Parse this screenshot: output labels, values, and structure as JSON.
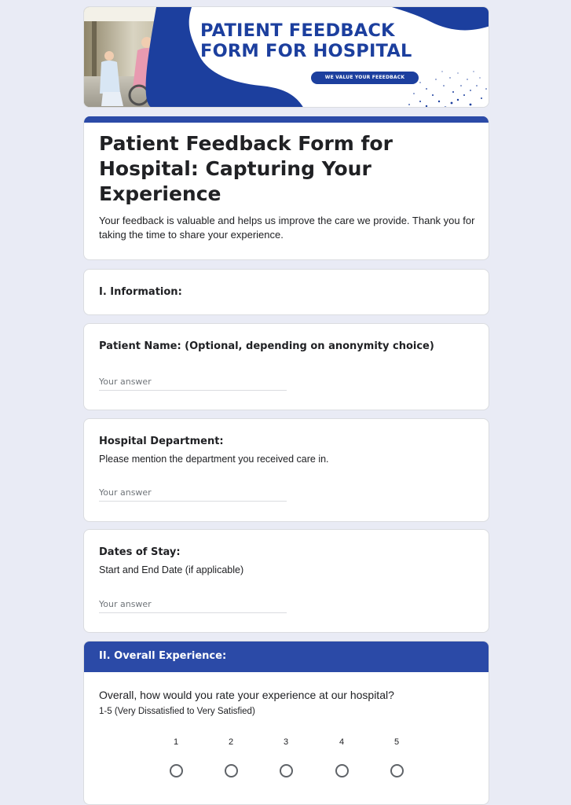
{
  "banner": {
    "title_line1": "PATIENT FEEDBACK",
    "title_line2": "FORM FOR HOSPITAL",
    "tagline": "WE VALUE YOUR FEEEDBACK"
  },
  "form": {
    "title": "Patient Feedback Form for Hospital: Capturing Your Experience",
    "description": "Your feedback is valuable and helps us improve the care we provide. Thank you for taking the time to share your experience."
  },
  "section_info": {
    "label": "I. Information:"
  },
  "questions": [
    {
      "title": "Patient Name: (Optional, depending on anonymity choice)",
      "description": "",
      "placeholder": "Your answer"
    },
    {
      "title": "Hospital Department:",
      "description": "Please mention the department you received care in.",
      "placeholder": "Your answer"
    },
    {
      "title": "Dates of Stay:",
      "description": "Start and End Date (if applicable)",
      "placeholder": "Your answer"
    }
  ],
  "section_experience": {
    "label": "II. Overall Experience:",
    "question": "Overall, how would you rate your experience at our hospital?",
    "description": "1-5 (Very Dissatisfied to Very Satisfied)",
    "scale": [
      "1",
      "2",
      "3",
      "4",
      "5"
    ]
  },
  "colors": {
    "accent": "#2b4aa7",
    "banner_blue": "#1c3f9e",
    "background": "#e9ebf5"
  }
}
